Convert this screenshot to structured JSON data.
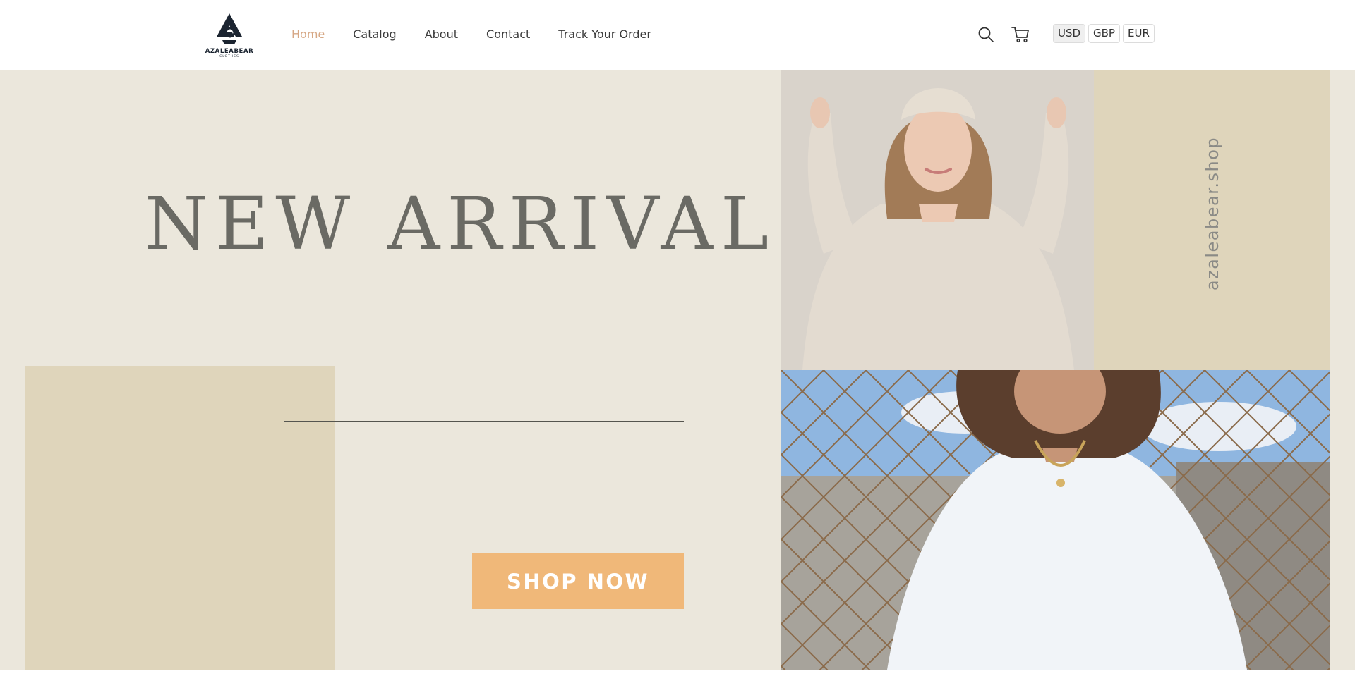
{
  "brand": {
    "name": "AZALEABEAR",
    "tagline": "CLOTHES",
    "logo_icon": "azaleabear-logo-icon"
  },
  "nav": {
    "items": [
      {
        "label": "Home",
        "active": true
      },
      {
        "label": "Catalog",
        "active": false
      },
      {
        "label": "About",
        "active": false
      },
      {
        "label": "Contact",
        "active": false
      },
      {
        "label": "Track Your Order",
        "active": false
      }
    ]
  },
  "header_icons": {
    "search": "search-icon",
    "cart": "cart-icon"
  },
  "currencies": {
    "options": [
      "USD",
      "GBP",
      "EUR"
    ],
    "selected": "USD"
  },
  "hero": {
    "title": "NEW ARRIVALS",
    "cta_label": "SHOP NOW",
    "side_text": "azaleabear.shop"
  },
  "colors": {
    "hero_bg": "#ebe7dc",
    "tan": "#dfd5bb",
    "accent_nav": "#d6a784",
    "cta_bg": "#f0b879",
    "logo": "#1b2430"
  }
}
